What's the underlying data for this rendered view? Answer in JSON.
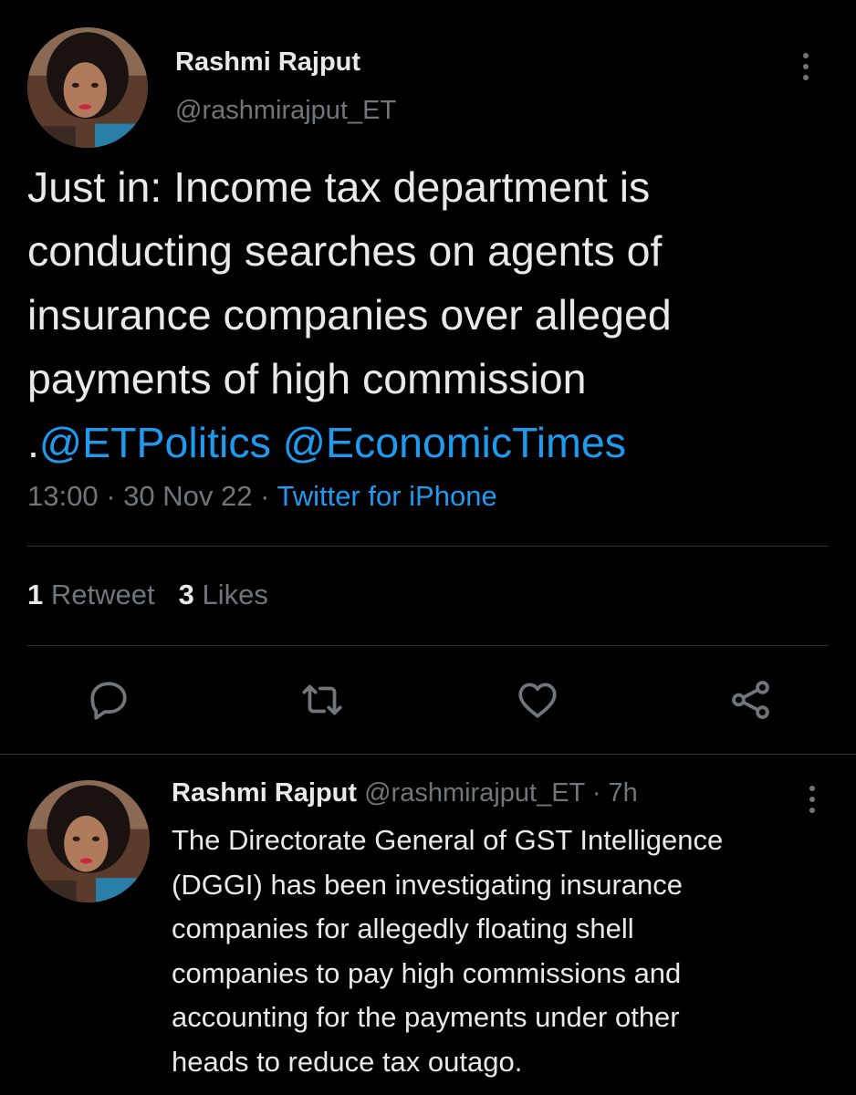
{
  "main_tweet": {
    "author_name": "Rashmi Rajput",
    "author_handle": "@rashmirajput_ET",
    "text_lines": [
      "Just in: Income tax department is",
      "conducting searches on agents of",
      "insurance companies over alleged",
      "payments of high commission"
    ],
    "text_prefix": ".",
    "mentions": [
      "@ETPolitics",
      "@EconomicTimes"
    ],
    "time": "13:00",
    "date": "30 Nov 22",
    "separator": " · ",
    "source": "Twitter for iPhone",
    "retweet_count": "1",
    "retweet_label": "Retweet",
    "like_count": "3",
    "like_label": "Likes",
    "actions": [
      "reply-icon",
      "retweet-icon",
      "like-icon",
      "share-icon"
    ]
  },
  "reply_tweet": {
    "author_name": "Rashmi Rajput",
    "author_handle": "@rashmirajput_ET",
    "age": "7h",
    "separator": " · ",
    "text_lines": [
      "The Directorate General of GST Intelligence",
      "(DGGI) has been investigating insurance",
      "companies for allegedly floating shell",
      "companies to pay high commissions and",
      "accounting for the payments under other",
      "heads to reduce tax outago."
    ]
  },
  "colors": {
    "background": "#000000",
    "text_primary": "#e7e9ea",
    "text_secondary": "#71767b",
    "accent": "#1d9bf0",
    "divider": "#2f3336"
  }
}
